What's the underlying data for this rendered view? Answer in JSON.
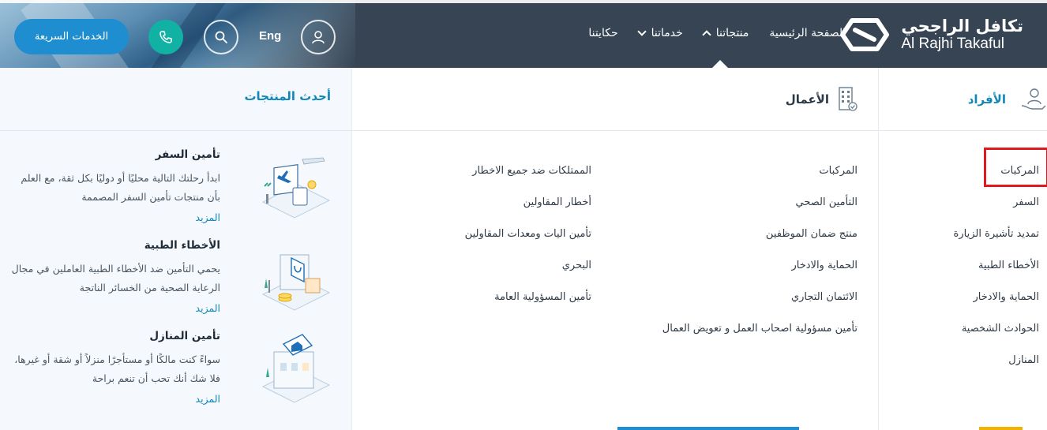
{
  "brand": {
    "name_ar": "تكافل الراجحي",
    "name_en": "Al Rajhi Takaful"
  },
  "nav": {
    "home": "الصفحة الرئيسية",
    "products": "منتجاتنا",
    "services": "خدماتنا",
    "stories": "حكايتنا"
  },
  "header": {
    "language": "Eng",
    "quick_services": "الخدمات السريعة"
  },
  "columns": {
    "individuals": {
      "title": "الأفراد",
      "items": [
        "المركبات",
        "السفر",
        "تمديد تأشيرة الزيارة",
        "الأخطاء الطبية",
        "الحماية والادخار",
        "الحوادث الشخصية",
        "المنازل"
      ]
    },
    "business": {
      "title": "الأعمال",
      "items_a": [
        "المركبات",
        "التأمين الصحي",
        "منتج ضمان الموظفين",
        "الحماية والادخار",
        "الائتمان التجاري",
        "تأمين مسؤولية اصحاب العمل و تعويض العمال"
      ],
      "items_b": [
        "الممتلكات ضد جميع الاخطار",
        "أخطار المقاولين",
        "تأمين اليات ومعدات المقاولين",
        "البحري",
        "تأمين المسؤولية العامة"
      ]
    },
    "latest": {
      "title": "أحدث المنتجات",
      "products": [
        {
          "title": "تأمين السفر",
          "desc": "ابدأ رحلتك التالية محليًا أو دوليًا بكل ثقة، مع العلم بأن منتجات تأمين السفر المصممة",
          "more": "المزيد",
          "icon": "travel-illustration"
        },
        {
          "title": "الأخطاء الطبية",
          "desc": "يحمي التأمين ضد الأخطاء الطبية العاملين في مجال الرعاية الصحية من الخسائر الناتجة",
          "more": "المزيد",
          "icon": "medical-illustration"
        },
        {
          "title": "تأمين المنازل",
          "desc": "سواءً كنت مالكًا أو مستأجرًا منزلاً أو شقة أو غيرها، فلا شك أنك تحب أن تنعم براحة",
          "more": "المزيد",
          "icon": "home-illustration"
        }
      ]
    }
  },
  "colors": {
    "header_bg": "#364453",
    "accent_teal": "#11b2a4",
    "accent_blue": "#1e8ed1",
    "link_blue": "#1187b8",
    "highlight_red": "#e0191d"
  }
}
